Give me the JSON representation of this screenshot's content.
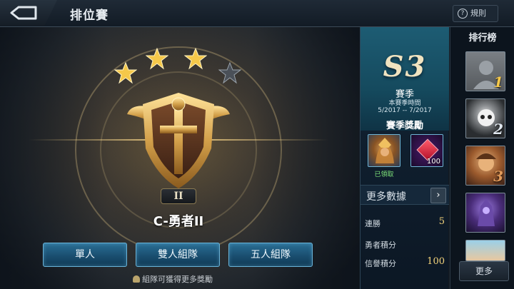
{
  "header": {
    "title": "排位賽",
    "rules_label": "規則",
    "rules_icon": "?"
  },
  "rank": {
    "stars_earned": 3,
    "stars_total": 4,
    "tier_numeral": "II",
    "name": "C-勇者II"
  },
  "modes": [
    {
      "label": "單人"
    },
    {
      "label": "雙人組隊"
    },
    {
      "label": "五人組隊"
    }
  ],
  "hint": "組隊可獲得更多獎勵",
  "season": {
    "code": "S3",
    "label": "賽季",
    "subtitle": "本賽季時間",
    "dates": "5/2017 -- 7/2017",
    "rewards_title": "賽季獎勵",
    "rewards": [
      {
        "icon": "hero-portrait",
        "claimed_label": "已領取"
      },
      {
        "icon": "red-gem",
        "count": "100"
      }
    ],
    "more_data_label": "更多數據",
    "more_data_arrow": "›",
    "stats": [
      {
        "label": "連勝",
        "value": "5"
      },
      {
        "label": "勇者積分",
        "value": ""
      },
      {
        "label": "信譽積分",
        "value": "100"
      }
    ]
  },
  "leaderboard": {
    "title": "排行榜",
    "ranks": [
      "1",
      "2",
      "3"
    ],
    "more_label": "更多"
  },
  "colors": {
    "accent_gold": "#f2d27a",
    "button_blue": "#2a6f95",
    "season_teal": "#1d5c73",
    "claimed_green": "#7ee37a"
  }
}
